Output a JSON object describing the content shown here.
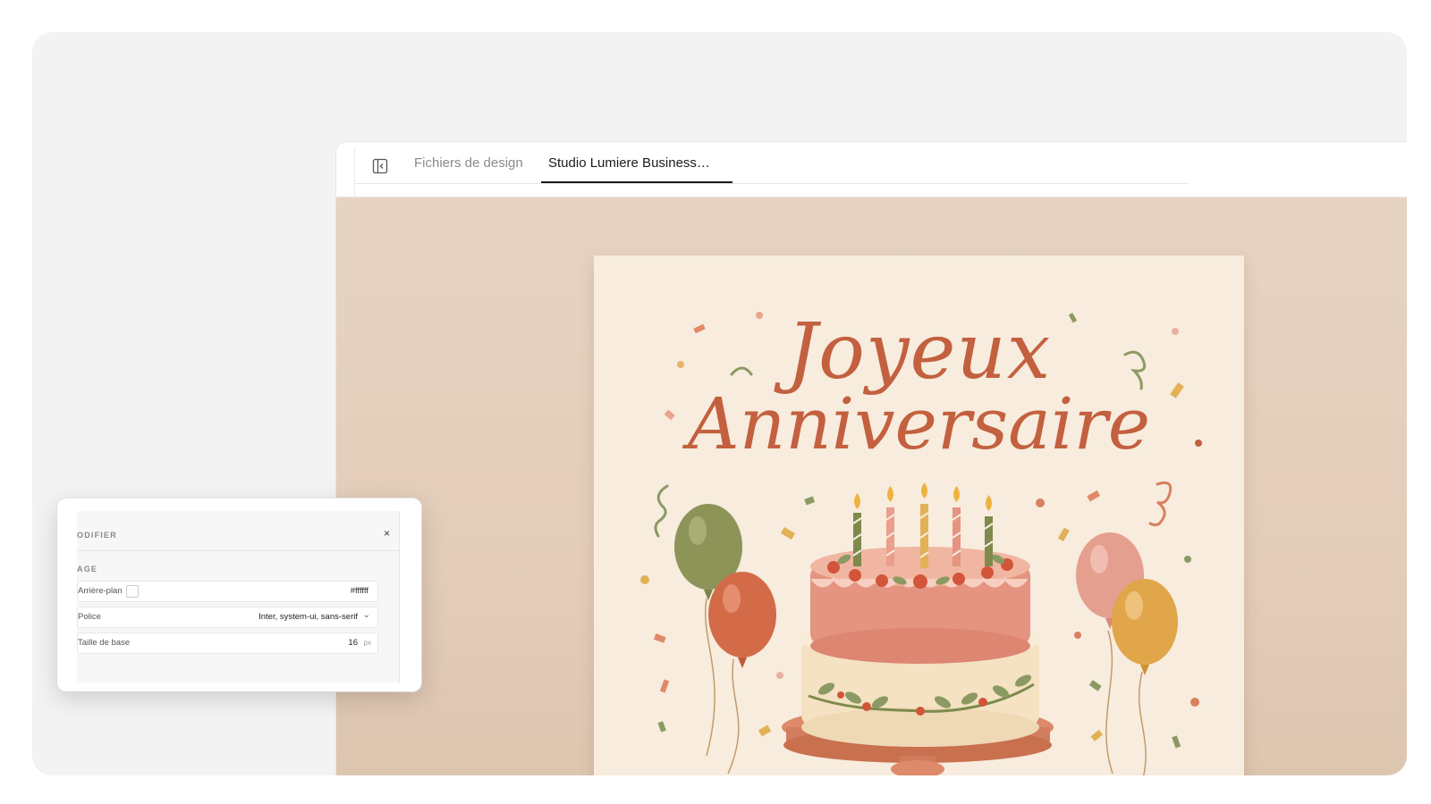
{
  "tabs": {
    "design_files": "Fichiers de design",
    "active_document": "Studio Lumiere Business…"
  },
  "card": {
    "line1": "Joyeux",
    "line2": "Anniversaire"
  },
  "panel": {
    "title": "ODIFIER",
    "close": "×",
    "section": "AGE",
    "background_label": "Arrière-plan",
    "background_value": "#ffffff",
    "font_label": "Police",
    "font_value": "Inter, system-ui, sans-serif",
    "base_size_label": "Taille de base",
    "base_size_value": "16",
    "base_size_unit": "px"
  },
  "colors": {
    "accent": "#c3603f",
    "canvas_bg": "#e4cfbc",
    "card_bg": "#f7ecdd"
  },
  "icons": {
    "sidebar_toggle": "sidebar-panel-icon",
    "dropdown": "chevron-down-icon"
  }
}
